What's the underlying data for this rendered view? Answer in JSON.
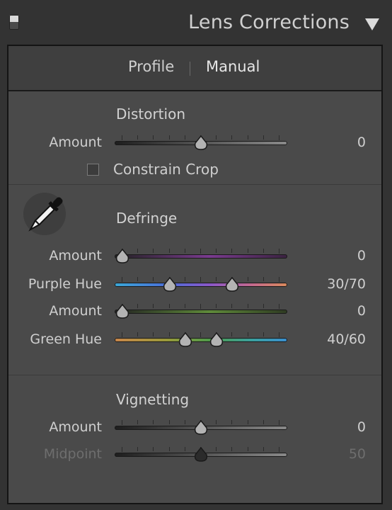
{
  "panel": {
    "title": "Lens Corrections"
  },
  "tabs": [
    {
      "label": "Profile"
    },
    {
      "label": "Manual"
    }
  ],
  "distortion": {
    "title": "Distortion",
    "amount": {
      "label": "Amount",
      "value": "0",
      "fraction": 0.5
    },
    "constrain_crop": {
      "label": "Constrain Crop",
      "checked": false
    }
  },
  "defringe": {
    "title": "Defringe",
    "purple_amount": {
      "label": "Amount",
      "value": "0",
      "fraction": 0.0
    },
    "purple_hue": {
      "label": "Purple Hue",
      "value": "30/70",
      "range": [
        0.3,
        0.7
      ]
    },
    "green_amount": {
      "label": "Amount",
      "value": "0",
      "fraction": 0.0
    },
    "green_hue": {
      "label": "Green Hue",
      "value": "40/60",
      "range": [
        0.4,
        0.6
      ]
    }
  },
  "vignetting": {
    "title": "Vignetting",
    "amount": {
      "label": "Amount",
      "value": "0",
      "fraction": 0.5
    },
    "midpoint": {
      "label": "Midpoint",
      "value": "50",
      "fraction": 0.5,
      "disabled": true
    }
  },
  "icons": {
    "eyedropper": "eyedropper-icon",
    "collapse": "triangle-down-icon"
  },
  "colors": {
    "background": "#4a4a4a",
    "header": "#333333",
    "text": "#cfcfcf"
  }
}
